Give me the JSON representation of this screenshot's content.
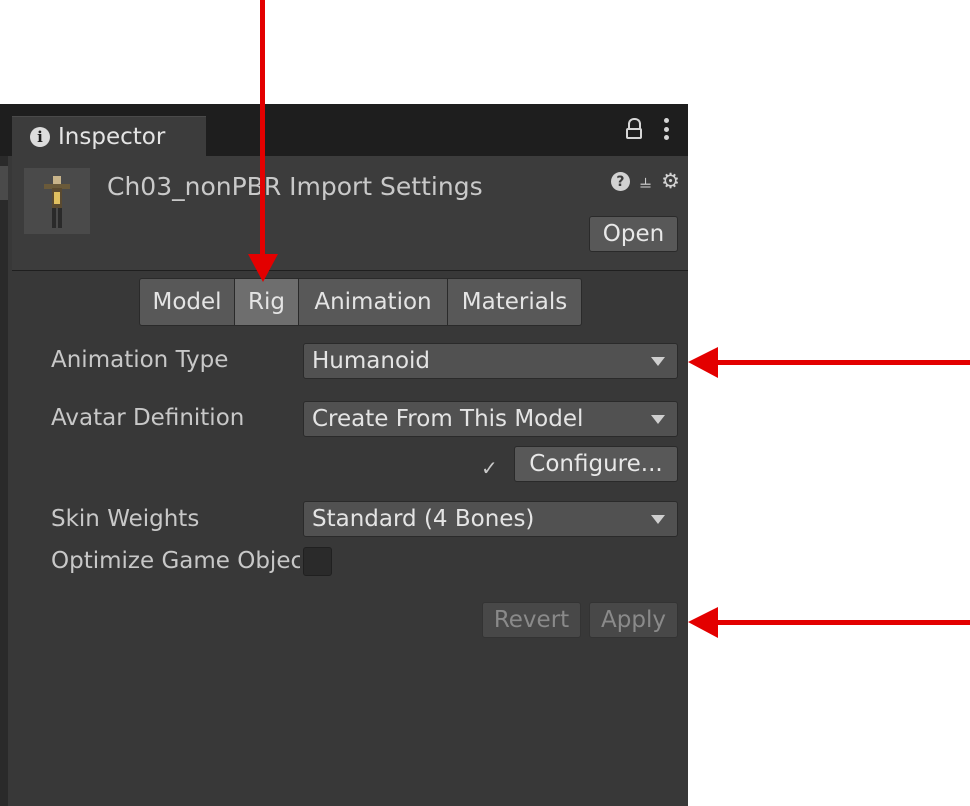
{
  "inspector_tab": {
    "label": "Inspector"
  },
  "header": {
    "title": "Ch03_nonPBR Import Settings",
    "open_button": "Open"
  },
  "tabs": [
    {
      "label": "Model",
      "active": false
    },
    {
      "label": "Rig",
      "active": true
    },
    {
      "label": "Animation",
      "active": false
    },
    {
      "label": "Materials",
      "active": false
    }
  ],
  "rig": {
    "animation_type": {
      "label": "Animation Type",
      "value": "Humanoid"
    },
    "avatar_definition": {
      "label": "Avatar Definition",
      "value": "Create From This Model"
    },
    "configure_check": "✓",
    "configure_button": "Configure...",
    "skin_weights": {
      "label": "Skin Weights",
      "value": "Standard (4 Bones)"
    },
    "optimize_game_objects": {
      "label": "Optimize Game Objects",
      "checked": false
    }
  },
  "footer": {
    "revert": "Revert",
    "apply": "Apply"
  },
  "colors": {
    "annotation_arrow": "#e30000",
    "panel_bg": "#383838"
  },
  "icons": [
    "info-icon",
    "lock-icon",
    "kebab-menu-icon",
    "help-icon",
    "preset-icon",
    "gear-icon",
    "dropdown-caret-icon",
    "check-icon"
  ]
}
